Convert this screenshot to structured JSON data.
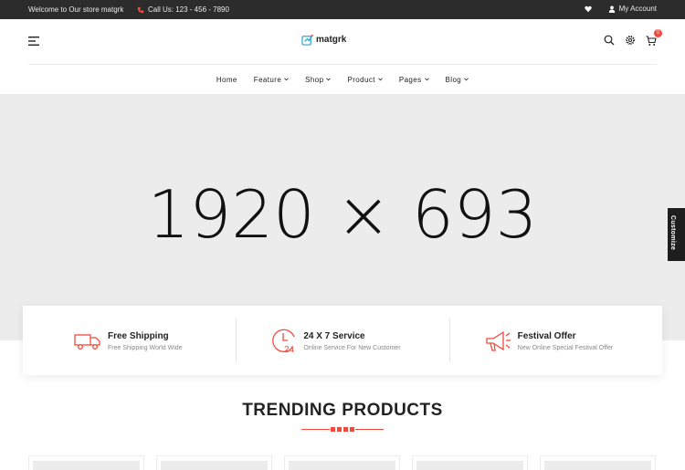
{
  "topbar": {
    "welcome": "Welcome to Our store matgrk",
    "call": "Call Us: 123 - 456 - 7890",
    "account": "My Account",
    "icons": [
      "phone-icon",
      "heart-icon",
      "user-icon"
    ]
  },
  "header": {
    "logo_text": "matgrk",
    "cart_count": "0",
    "icons": [
      "menu-icon",
      "logo-icon",
      "search-icon",
      "gear-icon",
      "cart-icon"
    ]
  },
  "nav": {
    "items": [
      {
        "label": "Home",
        "has_dropdown": false
      },
      {
        "label": "Feature",
        "has_dropdown": true
      },
      {
        "label": "Shop",
        "has_dropdown": true
      },
      {
        "label": "Product",
        "has_dropdown": true
      },
      {
        "label": "Pages",
        "has_dropdown": true
      },
      {
        "label": "Blog",
        "has_dropdown": true
      }
    ]
  },
  "hero": {
    "placeholder_text": "1920 × 693"
  },
  "customize": {
    "label": "Customize"
  },
  "features": [
    {
      "title": "Free Shipping",
      "subtitle": "Free Shipping World Wide",
      "icon": "truck-icon"
    },
    {
      "title": "24 X 7 Service",
      "subtitle": "Online Service For New Customer",
      "icon": "clock-24-icon"
    },
    {
      "title": "Festival Offer",
      "subtitle": "New Online Special Festival Offer",
      "icon": "megaphone-icon"
    }
  ],
  "section": {
    "title": "TRENDING PRODUCTS"
  },
  "colors": {
    "accent": "#f24a3c",
    "topbar_bg": "#2c2c2c",
    "hero_bg": "#ececec",
    "text": "#222222"
  }
}
